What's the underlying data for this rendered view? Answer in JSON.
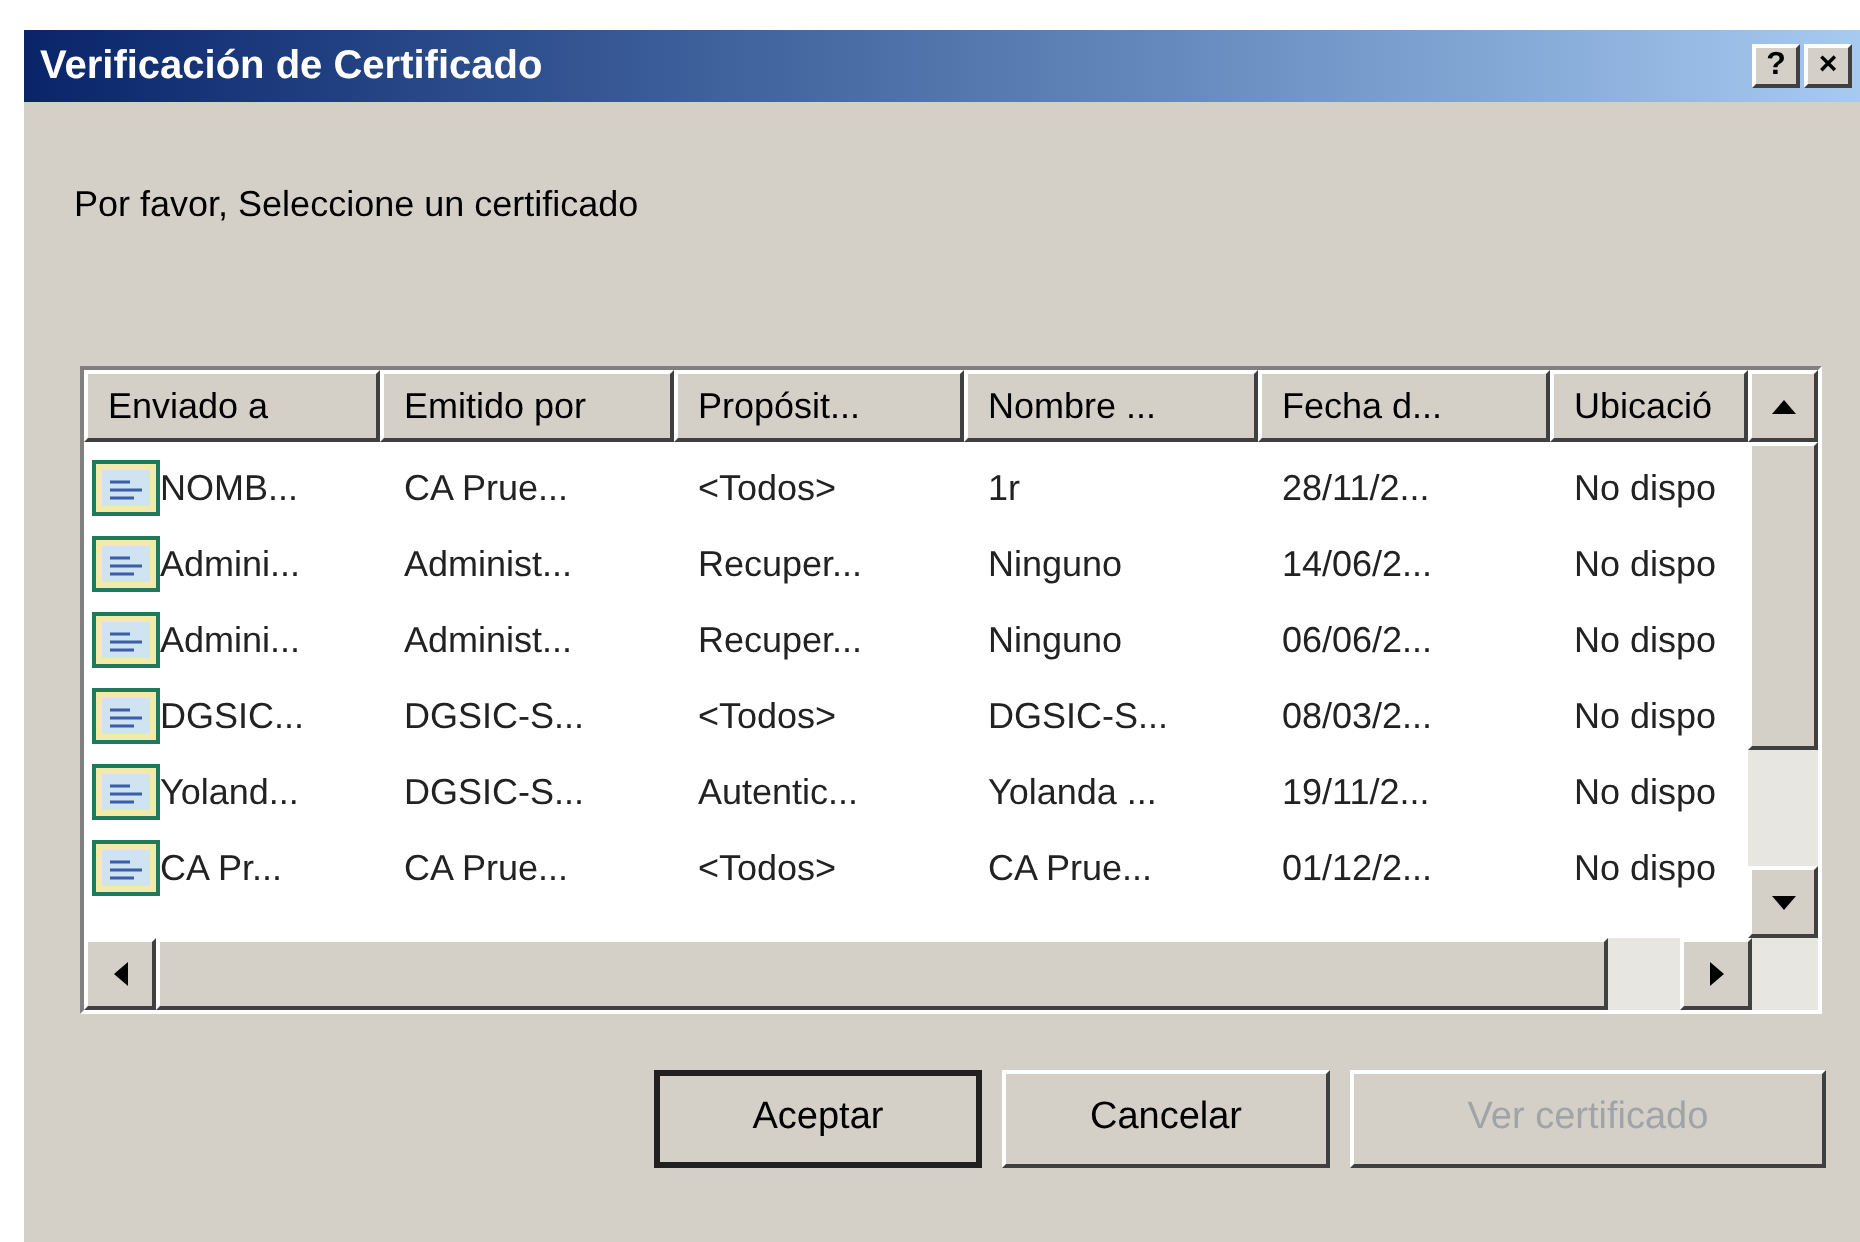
{
  "window": {
    "title": "Verificación de Certificado",
    "title_buttons": [
      "?",
      "×"
    ]
  },
  "prompt": "Por favor, Seleccione un certificado",
  "list": {
    "columns": [
      "Enviado a",
      "Emitido por",
      "Propósit...",
      "Nombre ...",
      "Fecha d...",
      "Ubicació"
    ],
    "rows": [
      {
        "cells": [
          "NOMB...",
          "CA Prue...",
          "<Todos>",
          "1r",
          "28/11/2...",
          "No dispo"
        ]
      },
      {
        "cells": [
          "Admini...",
          "Administ...",
          "Recuper...",
          "Ninguno",
          "14/06/2...",
          "No dispo"
        ]
      },
      {
        "cells": [
          "Admini...",
          "Administ...",
          "Recuper...",
          "Ninguno",
          "06/06/2...",
          "No dispo"
        ]
      },
      {
        "cells": [
          "DGSIC...",
          "DGSIC-S...",
          "<Todos>",
          "DGSIC-S...",
          "08/03/2...",
          "No dispo"
        ]
      },
      {
        "cells": [
          "Yoland...",
          "DGSIC-S...",
          "Autentic...",
          "Yolanda ...",
          "19/11/2...",
          "No dispo"
        ]
      },
      {
        "cells": [
          "CA Pr...",
          "CA Prue...",
          "<Todos>",
          "CA Prue...",
          "01/12/2...",
          "No dispo"
        ]
      }
    ]
  },
  "buttons": [
    {
      "label": "Aceptar",
      "default": true,
      "disabled": false
    },
    {
      "label": "Cancelar",
      "default": false,
      "disabled": false
    },
    {
      "label": "Ver certificado",
      "default": false,
      "disabled": true
    }
  ]
}
